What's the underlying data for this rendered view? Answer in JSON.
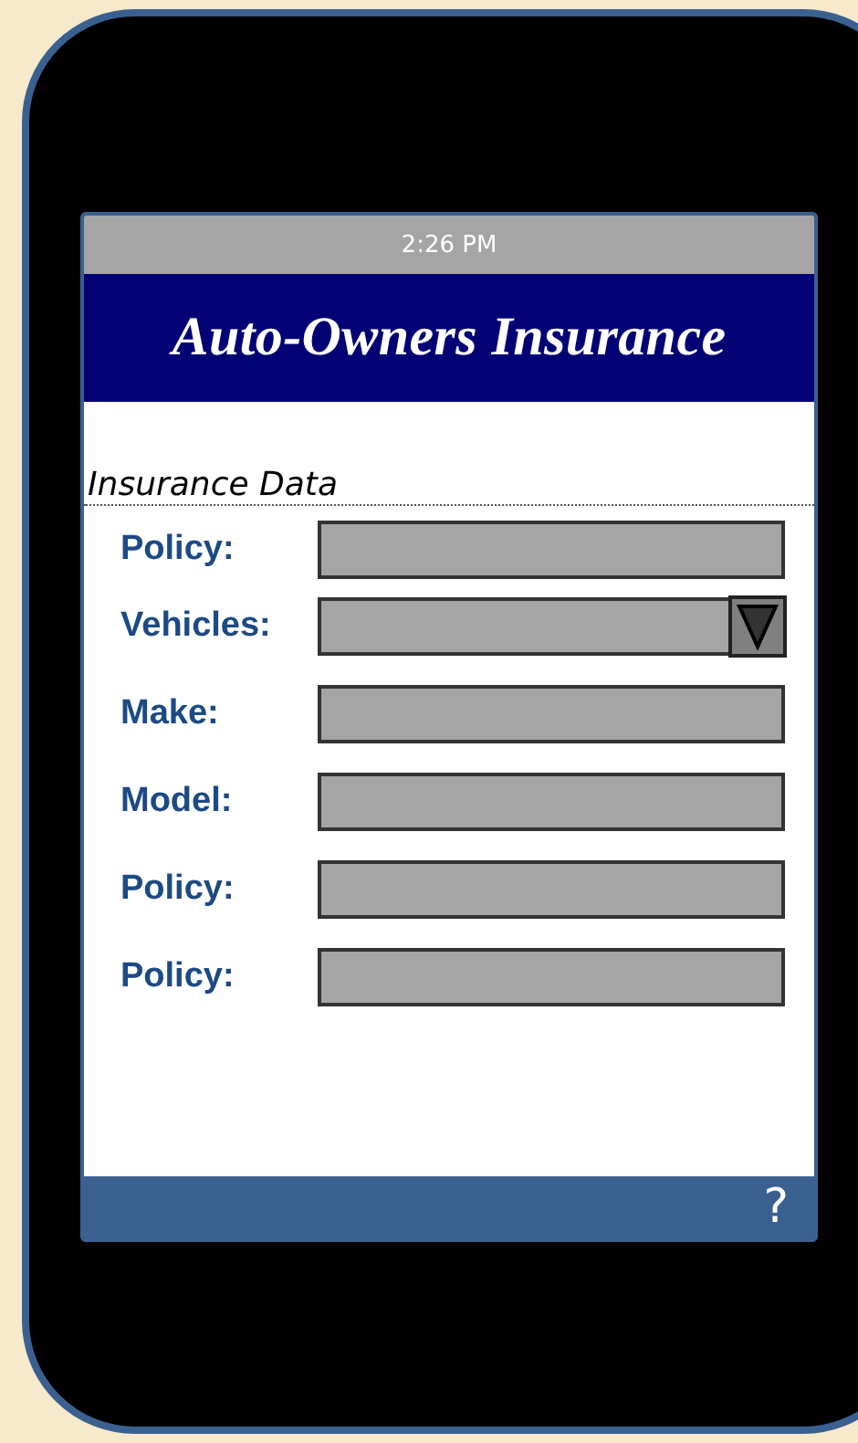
{
  "status_bar": {
    "time": "2:26 PM"
  },
  "header": {
    "logo": "Auto-Owners Insurance"
  },
  "section": {
    "title": "Insurance Data"
  },
  "fields": [
    {
      "label": "Policy:",
      "kind": "text"
    },
    {
      "label": "Vehicles:",
      "kind": "dropdown"
    },
    {
      "label": "Make:",
      "kind": "text"
    },
    {
      "label": "Model:",
      "kind": "text"
    },
    {
      "label": "Policy:",
      "kind": "text"
    },
    {
      "label": "Policy:",
      "kind": "text"
    }
  ],
  "footer": {
    "help": "?"
  }
}
